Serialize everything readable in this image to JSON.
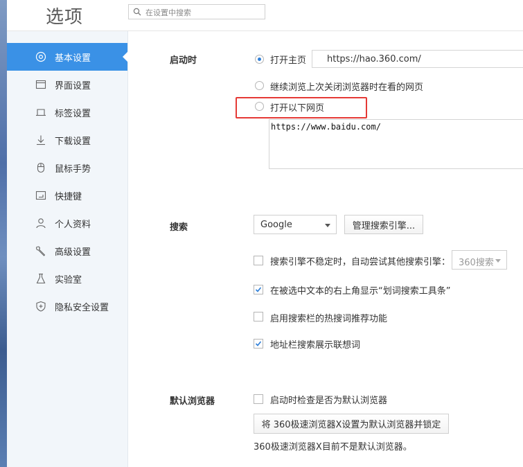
{
  "header": {
    "title": "选项",
    "search_placeholder": "在设置中搜索"
  },
  "sidebar": {
    "items": [
      {
        "label": "基本设置",
        "icon": "target-icon"
      },
      {
        "label": "界面设置",
        "icon": "window-icon"
      },
      {
        "label": "标签设置",
        "icon": "tab-icon"
      },
      {
        "label": "下载设置",
        "icon": "download-icon"
      },
      {
        "label": "鼠标手势",
        "icon": "mouse-icon"
      },
      {
        "label": "快捷键",
        "icon": "keyboard-icon"
      },
      {
        "label": "个人资料",
        "icon": "user-icon"
      },
      {
        "label": "高级设置",
        "icon": "wrench-icon"
      },
      {
        "label": "实验室",
        "icon": "flask-icon"
      },
      {
        "label": "隐私安全设置",
        "icon": "shield-icon"
      }
    ],
    "active_index": 0
  },
  "startup": {
    "label": "启动时",
    "open_home_label": "打开主页",
    "home_url": "https://hao.360.com/",
    "continue_label": "继续浏览上次关闭浏览器时在看的网页",
    "open_pages_label": "打开以下网页",
    "pages_value": "https://www.baidu.com/",
    "selected": "open_home"
  },
  "search": {
    "label": "搜索",
    "engine_selected": "Google",
    "manage_button": "管理搜索引擎...",
    "fallback_label": "搜索引擎不稳定时，自动尝试其他搜索引擎：",
    "fallback_engine": "360搜索",
    "toolbar_label": "在被选中文本的右上角显示“划词搜索工具条”",
    "hotwords_label": "启用搜索栏的热搜词推荐功能",
    "suggest_label": "地址栏搜索展示联想词",
    "checked": {
      "fallback": false,
      "toolbar": true,
      "hotwords": false,
      "suggest": true
    }
  },
  "default_browser": {
    "label": "默认浏览器",
    "check_label": "启动时检查是否为默认浏览器",
    "set_button": "将 360极速浏览器X设置为默认浏览器并锁定",
    "status": "360极速浏览器X目前不是默认浏览器。",
    "checked": false
  },
  "colors": {
    "accent": "#3a91e6",
    "highlight": "#e53935",
    "sidebar_bg": "#f2f6fa"
  }
}
